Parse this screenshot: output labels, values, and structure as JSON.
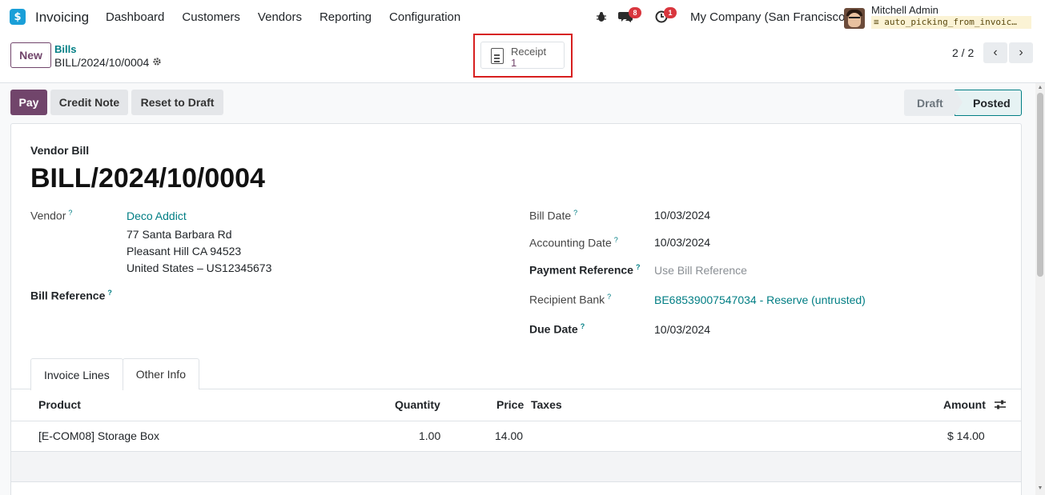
{
  "navbar": {
    "app_name": "Invoicing",
    "menu": [
      "Dashboard",
      "Customers",
      "Vendors",
      "Reporting",
      "Configuration"
    ],
    "messages_count": "8",
    "activities_count": "1",
    "company": "My Company (San Francisco)",
    "user_name": "Mitchell Admin",
    "database": "auto_picking_from_invoic…"
  },
  "control": {
    "new_label": "New",
    "breadcrumb_parent": "Bills",
    "breadcrumb_current": "BILL/2024/10/0004",
    "smart_button": {
      "label": "Receipt",
      "value": "1"
    },
    "pager": "2 / 2"
  },
  "actions": {
    "pay": "Pay",
    "credit_note": "Credit Note",
    "reset_to_draft": "Reset to Draft"
  },
  "status": {
    "draft": "Draft",
    "posted": "Posted",
    "current": "Posted"
  },
  "form": {
    "type_label": "Vendor Bill",
    "title": "BILL/2024/10/0004",
    "vendor_label": "Vendor",
    "vendor_name": "Deco Addict",
    "vendor_address": [
      "77 Santa Barbara Rd",
      "Pleasant Hill CA 94523",
      "United States – US12345673"
    ],
    "bill_reference_label": "Bill Reference",
    "bill_date_label": "Bill Date",
    "bill_date": "10/03/2024",
    "accounting_date_label": "Accounting Date",
    "accounting_date": "10/03/2024",
    "payment_reference_label": "Payment Reference",
    "payment_reference_placeholder": "Use Bill Reference",
    "recipient_bank_label": "Recipient Bank",
    "recipient_bank": "BE68539007547034 - Reserve (untrusted)",
    "due_date_label": "Due Date",
    "due_date": "10/03/2024",
    "help_marker": "?"
  },
  "tabs": [
    "Invoice Lines",
    "Other Info"
  ],
  "table": {
    "headers": {
      "product": "Product",
      "quantity": "Quantity",
      "price": "Price",
      "taxes": "Taxes",
      "amount": "Amount"
    },
    "rows": [
      {
        "product": "[E-COM08] Storage Box",
        "quantity": "1.00",
        "price": "14.00",
        "taxes": "",
        "amount": "$ 14.00"
      }
    ]
  },
  "colors": {
    "brand": "#71456b",
    "link": "#017e84",
    "highlight": "#d71f1f"
  }
}
